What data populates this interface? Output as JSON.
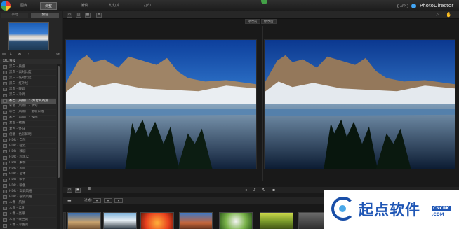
{
  "topbar": {
    "tabs": [
      {
        "label": "图库"
      },
      {
        "label": "调整"
      },
      {
        "label": "编辑"
      },
      {
        "label": "幻灯片"
      },
      {
        "label": "打印"
      }
    ],
    "brand_badge": "APP",
    "brand": "PhotoDirector"
  },
  "left_panel": {
    "tabs": [
      {
        "label": "手动"
      },
      {
        "label": "预设"
      }
    ],
    "section": "默认预设",
    "presets": [
      "黑白 - 质感",
      "黑白 - 高对比度",
      "黑白 - 低对比度",
      "黑白 - 红外线",
      "黑白 - 暖调",
      "黑白 - 冷调",
      "彩色（风景） - 秋/冬日风景",
      "彩色（风景） - 梦幻",
      "彩色（风景） - 温暖日落",
      "彩色（风景） - 夜晚",
      "复古 - 褪色",
      "复古 - 怀旧",
      "创意 - 色彩鲜明",
      "HDR - 自然",
      "HDR - 强烈",
      "HDR - 戏剧",
      "HDR - 超现实",
      "HDR - 柔和",
      "HDR - 黑白",
      "HDR - 艺术",
      "HDR - 细节",
      "HDR - 暖色",
      "HDR - 高调风格",
      "HDR - 低调风格",
      "人像 - 肌肤",
      "人像 - 柔化",
      "人像 - 亮眼",
      "人像 - 暖色调",
      "人像 - 冷色调",
      "人像 - 高对比度"
    ],
    "selected_index": 6
  },
  "main": {
    "compare_before": "修改前",
    "compare_after": "修改后",
    "film_filter_label": "过滤："
  },
  "watermark": {
    "text": "起点软件",
    "sub1": "CNCRK",
    "sub2": ".COM"
  },
  "colors": {
    "accent": "#4a4a4a",
    "background": "#1b1b1b",
    "watermark_blue": "#1f56b5"
  }
}
